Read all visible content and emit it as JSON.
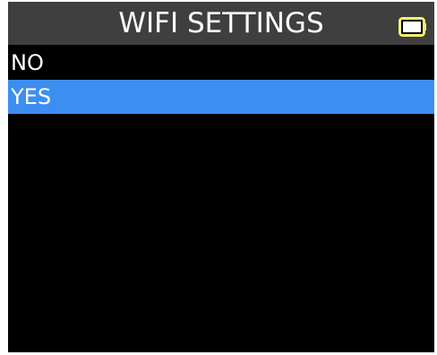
{
  "header": {
    "title": "WIFI SETTINGS",
    "battery_icon": "battery-icon",
    "battery_color": "#f4ef74"
  },
  "menu": {
    "items": [
      {
        "label": "NO",
        "selected": false
      },
      {
        "label": "YES",
        "selected": true
      }
    ],
    "selected_color": "#3d8ef1"
  }
}
